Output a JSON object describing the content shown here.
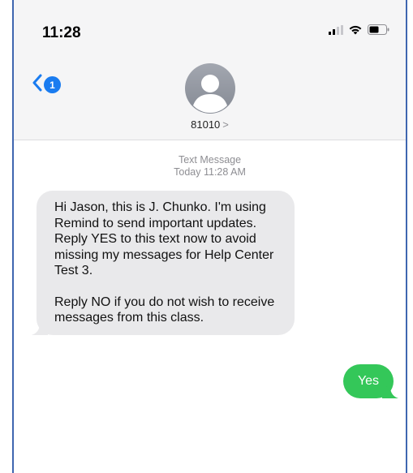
{
  "status_bar": {
    "time": "11:28",
    "icons": [
      "signal-icon",
      "wifi-icon",
      "battery-icon"
    ]
  },
  "header": {
    "back_badge_count": "1",
    "contact_number": "81010",
    "contact_chevron": ">"
  },
  "thread": {
    "meta_line1": "Text Message",
    "meta_line2": "Today 11:28 AM",
    "incoming": {
      "paragraph1": "Hi Jason, this is J. Chunko. I'm using Remind to send important updates. Reply YES to this text now to avoid missing my messages for Help Center Test 3.",
      "paragraph2": "Reply NO if you do not wish to receive messages from this class."
    },
    "outgoing": {
      "text": "Yes"
    }
  },
  "colors": {
    "accent": "#1a7cf0",
    "incoming_bubble": "#e9e9eb",
    "outgoing_bubble": "#34c759",
    "frame_border": "#3f66b0"
  }
}
